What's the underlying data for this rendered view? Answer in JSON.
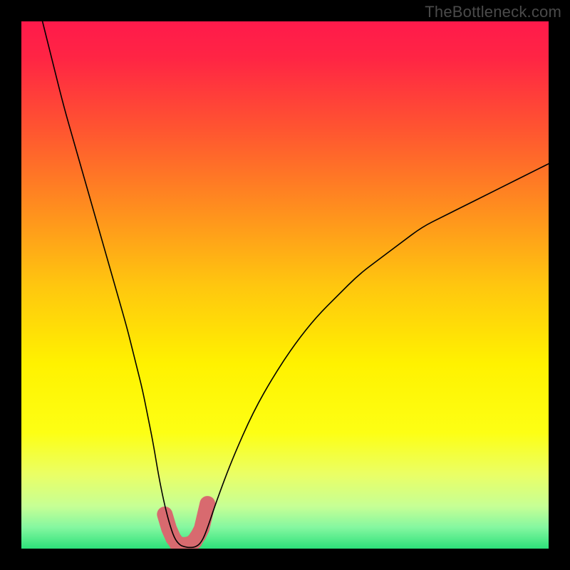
{
  "watermark": "TheBottleneck.com",
  "chart_data": {
    "type": "line",
    "title": "",
    "xlabel": "",
    "ylabel": "",
    "xlim": [
      0,
      100
    ],
    "ylim": [
      0,
      100
    ],
    "grid": false,
    "legend": false,
    "axes_visible": false,
    "background_gradient": {
      "stops": [
        {
          "pos": 0.0,
          "color": "#ff1a4b"
        },
        {
          "pos": 0.07,
          "color": "#ff2544"
        },
        {
          "pos": 0.2,
          "color": "#ff5331"
        },
        {
          "pos": 0.35,
          "color": "#ff8c1f"
        },
        {
          "pos": 0.5,
          "color": "#ffc60f"
        },
        {
          "pos": 0.65,
          "color": "#fff200"
        },
        {
          "pos": 0.78,
          "color": "#fdff14"
        },
        {
          "pos": 0.86,
          "color": "#eaff66"
        },
        {
          "pos": 0.92,
          "color": "#c6ff95"
        },
        {
          "pos": 0.96,
          "color": "#84f7a0"
        },
        {
          "pos": 1.0,
          "color": "#2de17a"
        }
      ]
    },
    "series": [
      {
        "name": "bottleneck-curve",
        "color": "#000000",
        "stroke_width": 1.6,
        "x": [
          4,
          6,
          8,
          10,
          12,
          14,
          16,
          18,
          20,
          21,
          22,
          23,
          24,
          25,
          26,
          27,
          28,
          29,
          30,
          31,
          32,
          33,
          34,
          35,
          37,
          40,
          44,
          48,
          52,
          56,
          60,
          64,
          68,
          72,
          76,
          80,
          84,
          88,
          92,
          96,
          100
        ],
        "y": [
          100,
          92,
          84,
          77,
          70,
          63,
          56,
          49,
          42,
          38,
          34,
          30,
          25,
          20,
          14,
          9,
          5,
          2,
          0.7,
          0.3,
          0.2,
          0.3,
          1.0,
          3,
          9,
          17,
          26,
          33,
          39,
          44,
          48,
          52,
          55,
          58,
          61,
          63,
          65,
          67,
          69,
          71,
          73
        ]
      }
    ],
    "markers": {
      "name": "highlighted-range",
      "color": "#d86a6f",
      "style": "round",
      "x": [
        27.2,
        28.0,
        28.8,
        29.6,
        30.4,
        31.2,
        32.0,
        32.8,
        33.6,
        34.2,
        35.3
      ],
      "y": [
        6.5,
        3.8,
        2.0,
        0.9,
        0.6,
        0.6,
        0.8,
        1.4,
        2.6,
        3.8,
        8.5
      ],
      "radius": [
        9,
        10,
        11,
        11.5,
        12,
        12,
        12,
        11.5,
        11,
        10,
        7
      ]
    }
  }
}
